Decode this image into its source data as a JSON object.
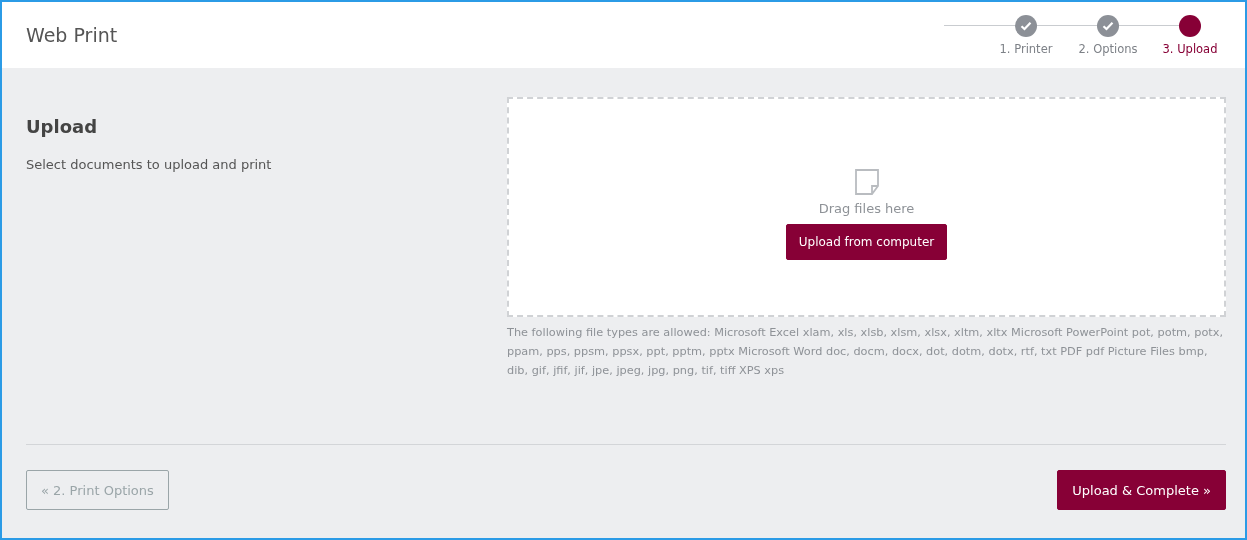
{
  "window": {
    "title": "Web Print"
  },
  "steps": [
    {
      "label": "1. Printer",
      "completed": true,
      "selected": false
    },
    {
      "label": "2. Options",
      "completed": true,
      "selected": false
    },
    {
      "label": "3. Upload",
      "completed": false,
      "selected": true
    }
  ],
  "section": {
    "title": "Upload",
    "description": "Select documents to upload and print"
  },
  "dropzone": {
    "hint": "Drag files here",
    "button": "Upload from computer"
  },
  "allowed_types": "The following file types are allowed: Microsoft Excel xlam, xls, xlsb, xlsm, xlsx, xltm, xltx Microsoft PowerPoint pot, potm, potx, ppam, pps, ppsm, ppsx, ppt, pptm, pptx Microsoft Word doc, docm, docx, dot, dotm, dotx, rtf, txt PDF pdf Picture Files bmp, dib, gif, jfif, jif, jpe, jpeg, jpg, png, tif, tiff XPS xps",
  "footer": {
    "back": {
      "label": "« 2. Print Options",
      "disabled": true
    },
    "next": {
      "label": "Upload & Complete »",
      "disabled": false
    }
  }
}
